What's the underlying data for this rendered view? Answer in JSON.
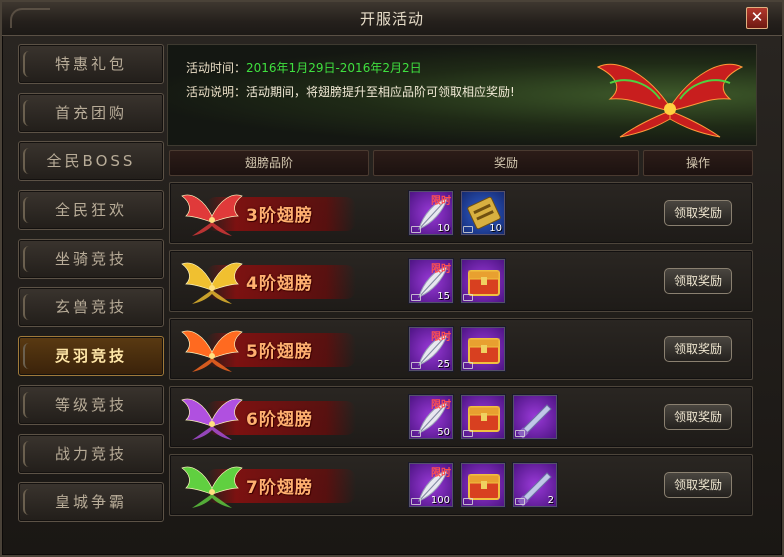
{
  "window": {
    "title": "开服活动"
  },
  "sidebar": {
    "items": [
      {
        "label": "特惠礼包",
        "active": false
      },
      {
        "label": "首充团购",
        "active": false
      },
      {
        "label": "全民BOSS",
        "active": false
      },
      {
        "label": "全民狂欢",
        "active": false
      },
      {
        "label": "坐骑竞技",
        "active": false
      },
      {
        "label": "玄兽竞技",
        "active": false
      },
      {
        "label": "灵羽竞技",
        "active": true
      },
      {
        "label": "等级竞技",
        "active": false
      },
      {
        "label": "战力竞技",
        "active": false
      },
      {
        "label": "皇城争霸",
        "active": false
      }
    ]
  },
  "banner": {
    "time_label": "活动时间：",
    "time_value": "2016年1月29日-2016年2月2日",
    "desc_label": "活动说明：",
    "desc_value": "活动期间，将翅膀提升至相应品阶可领取相应奖励!"
  },
  "table": {
    "headers": {
      "grade": "翅膀品阶",
      "reward": "奖励",
      "action": "操作"
    },
    "claim_label": "领取奖励",
    "limited_label": "限时",
    "rows": [
      {
        "tier": "3阶翅膀",
        "wing_color": "#e03a3a",
        "items": [
          {
            "type": "feather",
            "color": "purple",
            "count": "10",
            "limited": true
          },
          {
            "type": "scroll",
            "color": "blue",
            "count": "10",
            "limited": false
          }
        ]
      },
      {
        "tier": "4阶翅膀",
        "wing_color": "#f0c030",
        "items": [
          {
            "type": "feather",
            "color": "purple",
            "count": "15",
            "limited": true
          },
          {
            "type": "chest",
            "color": "purple",
            "count": "",
            "limited": false
          }
        ]
      },
      {
        "tier": "5阶翅膀",
        "wing_color": "#ff6a20",
        "items": [
          {
            "type": "feather",
            "color": "purple",
            "count": "25",
            "limited": true
          },
          {
            "type": "chest",
            "color": "purple",
            "count": "",
            "limited": false
          }
        ]
      },
      {
        "tier": "6阶翅膀",
        "wing_color": "#b050e0",
        "items": [
          {
            "type": "feather",
            "color": "purple",
            "count": "50",
            "limited": true
          },
          {
            "type": "chest",
            "color": "purple",
            "count": "",
            "limited": false
          },
          {
            "type": "blade",
            "color": "purple",
            "count": "",
            "limited": false
          }
        ]
      },
      {
        "tier": "7阶翅膀",
        "wing_color": "#60d040",
        "items": [
          {
            "type": "feather",
            "color": "purple",
            "count": "100",
            "limited": true
          },
          {
            "type": "chest",
            "color": "purple",
            "count": "",
            "limited": false
          },
          {
            "type": "blade",
            "color": "purple",
            "count": "2",
            "limited": false
          }
        ]
      }
    ]
  }
}
